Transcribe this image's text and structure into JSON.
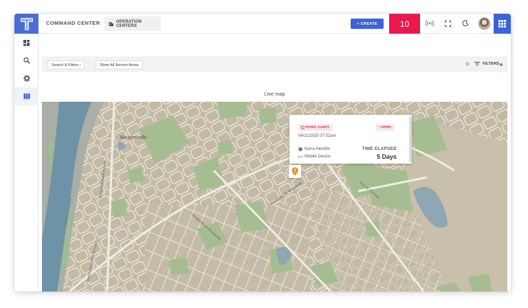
{
  "header": {
    "logo_letter": "T",
    "app_title": "COMMAND CENTER",
    "tab_label": "OPERATION CENTERS",
    "create_label": "+ CREATE",
    "alert_count": "10"
  },
  "sidebar": {
    "items": [
      {
        "icon": "dashboard-icon"
      },
      {
        "icon": "search-icon"
      },
      {
        "icon": "gear-icon"
      },
      {
        "icon": "map-icon",
        "active": true
      }
    ]
  },
  "filters": {
    "search_label": "Search & Filters ›",
    "service_areas_label": "Show All Service Areas",
    "filter_label": "FILTERS"
  },
  "map": {
    "title": "Live map",
    "place_labels": {
      "town": "Boucherville",
      "road_1": "Boulevard Marie-Victorin",
      "road_2": "Boulevard de Montarville",
      "road_3": "Boulevard de Montarville",
      "road_4": "Boulevard du Fort-St-Louis",
      "road_5": "Rue de Touraine",
      "river": "Fleuve Saint-Laurent"
    }
  },
  "incident": {
    "type": "PANIC ALERT",
    "status": "• OPEN",
    "timestamp": "04/11/2025 07:52am",
    "person": "Karra Hendrix",
    "device": "Mobile Device",
    "elapsed_label": "TIME ELAPSED",
    "elapsed_value": "5 Days"
  },
  "colors": {
    "brand": "#3d63d8",
    "badge": "#e8194d",
    "alert": "#d8243f",
    "marker": "#f08a24",
    "live_icon": "#3aa85a"
  }
}
